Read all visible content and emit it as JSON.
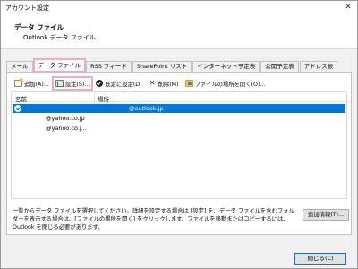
{
  "window": {
    "title": "アカウント設定"
  },
  "header": {
    "title": "データ ファイル",
    "subtitle": "Outlook データ ファイル"
  },
  "tabs": [
    {
      "label": "メール",
      "active": false
    },
    {
      "label": "データ ファイル",
      "active": true
    },
    {
      "label": "RSS フィード",
      "active": false
    },
    {
      "label": "SharePoint リスト",
      "active": false
    },
    {
      "label": "インターネット予定表",
      "active": false
    },
    {
      "label": "公開予定表",
      "active": false
    },
    {
      "label": "アドレス帳",
      "active": false
    }
  ],
  "toolbar": {
    "add_label": "追加(A)...",
    "settings_label": "設定(S)...",
    "default_label": "既定に設定(D)",
    "delete_label": "削除(M)",
    "open_location_label": "ファイルの場所を開く(O)..."
  },
  "list": {
    "columns": [
      "名前",
      "場所"
    ],
    "rows": [
      {
        "name": "@outlook.jp",
        "location": "",
        "selected": true,
        "default": true
      },
      {
        "name": "@yahoo.co.jp",
        "location": "",
        "selected": false,
        "default": false
      },
      {
        "name": "@yahoo.co.j...",
        "location": "",
        "selected": false,
        "default": false
      }
    ]
  },
  "description": "一覧からデータ ファイルを選択してください。詳細を設定する場合は [設定] を、データ ファイルを含むフォルダーを表示する場合は、[ファイルの場所を開く] をクリックします。ファイルを移動またはコピーするには、Outlook を閉じる必要があります。",
  "more_button": "追加情報(T)...",
  "close_button": "閉じる(C)",
  "colors": {
    "selection": "#0078d7",
    "highlight": "#f4a8c8"
  }
}
